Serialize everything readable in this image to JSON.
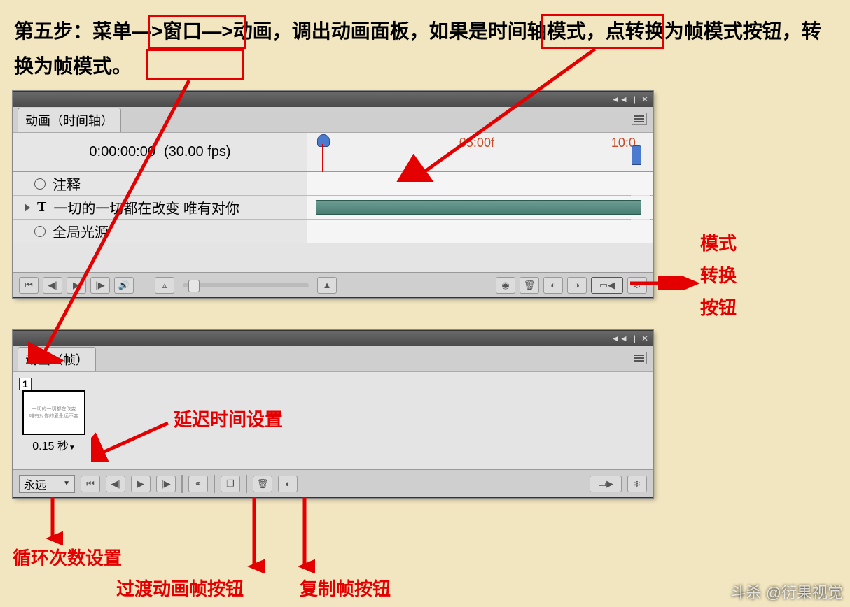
{
  "instruction_text": "第五步：菜单—>窗口—>动画，调出动画面板，如果是时间轴模式，点转换为帧模式按钮，转换为帧模式。",
  "timeline_panel": {
    "tab_label": "动画（时间轴）",
    "timecode": "0:00:00:00",
    "fps": "(30.00 fps)",
    "ruler_mark_1": "05:00f",
    "ruler_mark_2": "10:0",
    "track_comments": "注释",
    "track_text_layer": "一切的一切都在改变 唯有对你",
    "track_global_light": "全局光源"
  },
  "frame_panel": {
    "tab_label": "动画（帧）",
    "frame_number": "1",
    "frame_delay": "0.15 秒",
    "loop_label": "永远"
  },
  "annotations": {
    "mode_switch_1": "模式",
    "mode_switch_2": "转换",
    "mode_switch_3": "按钮",
    "delay_setting": "延迟时间设置",
    "loop_setting": "循环次数设置",
    "tween_button": "过渡动画帧按钮",
    "copy_button": "复制帧按钮"
  },
  "watermark": "斗杀 @衍果视觉"
}
